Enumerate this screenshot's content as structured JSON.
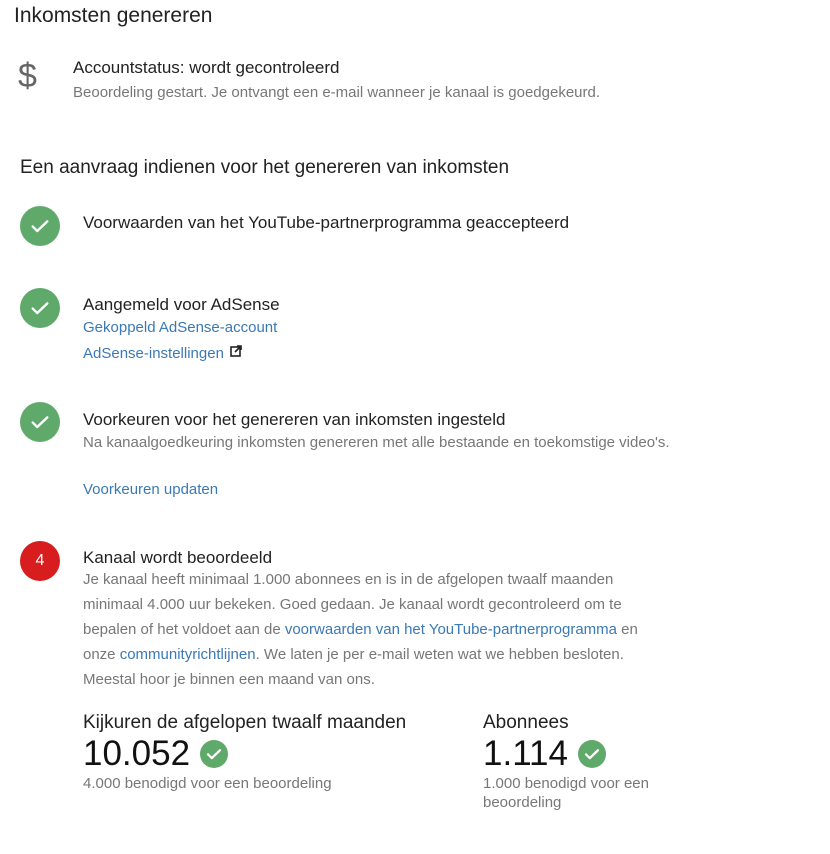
{
  "page": {
    "title": "Inkomsten genereren"
  },
  "account": {
    "icon": "dollar-icon",
    "symbol": "$",
    "status_title": "Accountstatus: wordt gecontroleerd",
    "status_sub": "Beoordeling gestart. Je ontvangt een e-mail wanneer je kanaal is goedgekeurd."
  },
  "section": {
    "title": "Een aanvraag indienen voor het genereren van inkomsten"
  },
  "steps": [
    {
      "state": "done",
      "title": "Voorwaarden van het YouTube-partnerprogramma geaccepteerd"
    },
    {
      "state": "done",
      "title": "Aangemeld voor AdSense",
      "link1": "Gekoppeld AdSense-account",
      "link2": "AdSense-instellingen"
    },
    {
      "state": "done",
      "title": "Voorkeuren voor het genereren van inkomsten ingesteld",
      "desc": "Na kanaalgoedkeuring inkomsten genereren met alle bestaande en toekomstige video's.",
      "link1": "Voorkeuren updaten"
    },
    {
      "state": "in-progress",
      "number": "4",
      "title": "Kanaal wordt beoordeeld",
      "desc_part1": "Je kanaal heeft minimaal 1.000 abonnees en is in de afgelopen twaalf maanden minimaal 4.000 uur bekeken. Goed gedaan. Je kanaal wordt gecontroleerd om te bepalen of het voldoet aan de ",
      "desc_link1": "voorwaarden van het YouTube-partnerprogramma",
      "desc_part2": " en onze ",
      "desc_link2": "communityrichtlijnen",
      "desc_part3": ". We laten je per e-mail weten wat we hebben besloten. Meestal hoor je binnen een maand van ons."
    }
  ],
  "metrics": [
    {
      "label": "Kijkuren de afgelopen twaalf maanden",
      "value": "10.052",
      "note": "4.000 benodigd voor een beoordeling"
    },
    {
      "label": "Abonnees",
      "value": "1.114",
      "note": "1.000 benodigd voor een beoordeling"
    }
  ],
  "colors": {
    "check_green": "#5fa96b",
    "step_red": "#d71d1d",
    "link_blue": "#3b79b5"
  }
}
